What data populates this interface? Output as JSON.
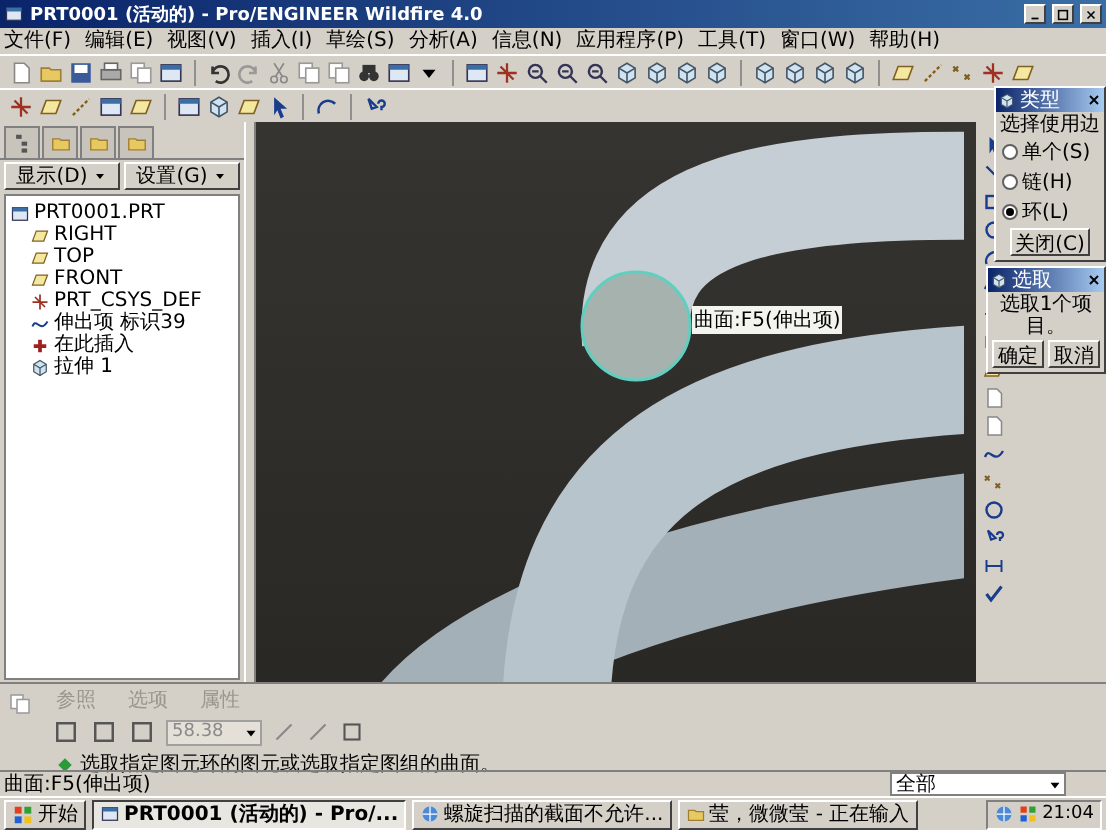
{
  "window": {
    "title": "PRT0001 (活动的) - Pro/ENGINEER Wildfire 4.0"
  },
  "menu": [
    "文件(F)",
    "编辑(E)",
    "视图(V)",
    "插入(I)",
    "草绘(S)",
    "分析(A)",
    "信息(N)",
    "应用程序(P)",
    "工具(T)",
    "窗口(W)",
    "帮助(H)"
  ],
  "model_tree": {
    "buttons": [
      "显示(D)",
      "设置(G)"
    ],
    "items": [
      {
        "label": "PRT0001.PRT",
        "kind": "part",
        "children": [
          {
            "label": "RIGHT",
            "kind": "plane"
          },
          {
            "label": "TOP",
            "kind": "plane"
          },
          {
            "label": "FRONT",
            "kind": "plane"
          },
          {
            "label": "PRT_CSYS_DEF",
            "kind": "csys"
          },
          {
            "label": "伸出项 标识39",
            "kind": "protrusion"
          },
          {
            "label": "在此插入",
            "kind": "insert"
          },
          {
            "label": "拉伸 1",
            "kind": "extrude"
          }
        ]
      }
    ]
  },
  "viewport": {
    "label": "曲面:F5(伸出项)"
  },
  "type_dialog": {
    "title": "类型",
    "prompt": "选择使用边",
    "options": [
      {
        "label": "单个(S)",
        "selected": false
      },
      {
        "label": "链(H)",
        "selected": false
      },
      {
        "label": "环(L)",
        "selected": true
      }
    ],
    "close_button": "关闭(C)"
  },
  "select_dialog": {
    "title": "选取",
    "message": "选取1个项目。",
    "buttons": [
      "确定",
      "取消"
    ]
  },
  "dashboard": {
    "tabs": [
      {
        "label": "参照",
        "disabled": true
      },
      {
        "label": "选项",
        "disabled": true
      },
      {
        "label": "属性",
        "disabled": true
      }
    ],
    "value": "58.38",
    "message": "选取指定图元环的图元或选取指定图组的曲面。"
  },
  "status_bar": {
    "text": "曲面:F5(伸出项)",
    "filter": "全部"
  },
  "taskbar": {
    "start": "开始",
    "tasks": [
      {
        "label": "PRT0001 (活动的) - Pro/...",
        "selected": true
      },
      {
        "label": "螺旋扫描的截面不允许...",
        "selected": false
      },
      {
        "label": "莹，微微莹 - 正在输入",
        "selected": false
      }
    ],
    "clock": "21:04"
  }
}
